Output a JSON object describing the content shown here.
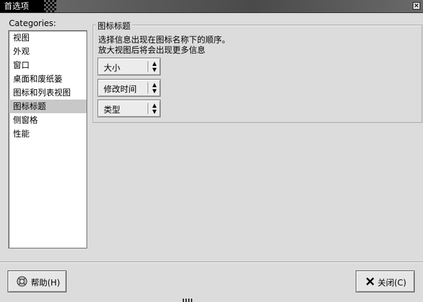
{
  "window": {
    "title": "首选项"
  },
  "sidebar": {
    "label": "Categories:",
    "items": [
      {
        "label": "视图"
      },
      {
        "label": "外观"
      },
      {
        "label": "窗口"
      },
      {
        "label": "桌面和废纸篓"
      },
      {
        "label": "图标和列表视图"
      },
      {
        "label": "图标标题",
        "selected": true
      },
      {
        "label": "侧窗格"
      },
      {
        "label": "性能"
      }
    ]
  },
  "main": {
    "group_title": "图标标题",
    "description_line1": "选择信息出现在图标名称下的顺序。",
    "description_line2": "放大视图后将会出现更多信息",
    "captions": [
      {
        "value": "大小"
      },
      {
        "value": "修改时间"
      },
      {
        "value": "类型"
      }
    ]
  },
  "footer": {
    "help_label": "帮助(H)",
    "close_label": "关闭(C)"
  },
  "icons": {
    "help": "help-lifebuoy-icon",
    "close": "close-x-icon",
    "spin": "up-down-arrows-icon"
  },
  "colors": {
    "window_bg": "#dcdcdc",
    "titlebar": "#4a4a4a",
    "selected_row": "#c8c8c8"
  }
}
